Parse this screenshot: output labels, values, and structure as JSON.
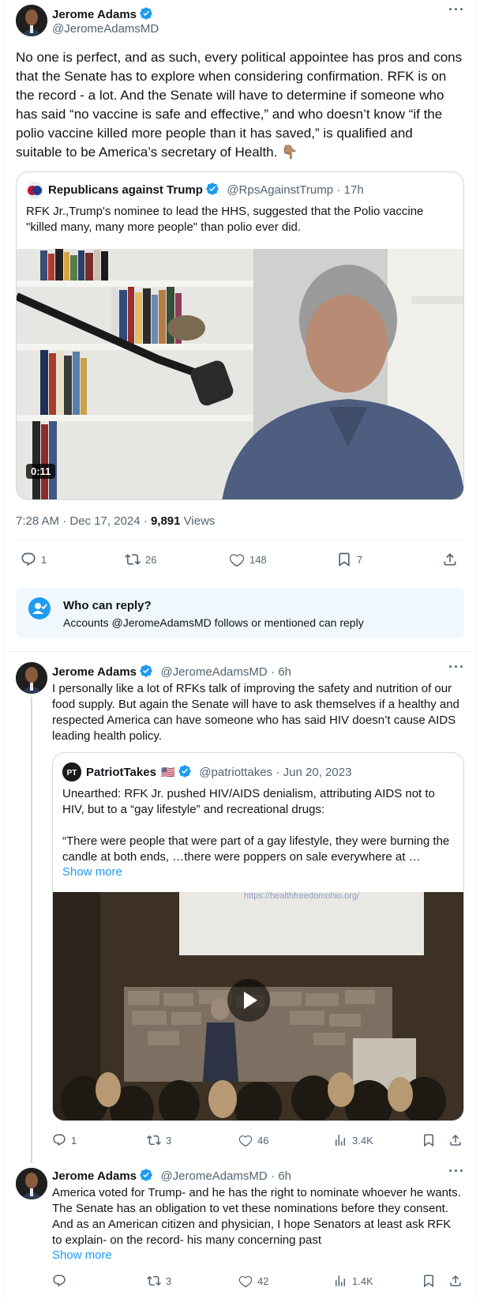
{
  "main_tweet": {
    "author_name": "Jerome Adams",
    "author_handle": "@JeromeAdamsMD",
    "text": "No one is perfect, and as such, every political appointee has pros and cons that the Senate has to explore when considering confirmation. RFK is on the record - a lot. And the Senate will have to determine if someone who has said “no vaccine is safe and effective,” and who doesn’t know “if the polio vaccine killed more people than it has saved,” is qualified and suitable to be America’s secretary of Health. 👇🏽",
    "quote": {
      "author_name": "Republicans against Trump",
      "author_handle": "@RpsAgainstTrump",
      "time": "· 17h",
      "text": "RFK Jr.,Trump's nominee to lead the HHS, suggested that the Polio vaccine \"killed many, many more people\" than polio ever did.",
      "video_duration": "0:11"
    },
    "timestamp": "7:28 AM · Dec 17, 2024 ·",
    "views_count": "9,891",
    "views_label": "Views",
    "replies": "1",
    "reposts": "26",
    "likes": "148",
    "bookmarks": "7",
    "who_can_reply_title": "Who can reply?",
    "who_can_reply_text": "Accounts @JeromeAdamsMD follows or mentioned can reply"
  },
  "reply_1": {
    "author_name": "Jerome Adams",
    "author_handle": "@JeromeAdamsMD",
    "time": "· 6h",
    "text": "I personally like a lot of RFKs talk of improving the safety and nutrition of our food supply. But again the Senate will have to ask themselves if a healthy and respected America can have someone who has said HIV doesn’t cause AIDS leading health policy.",
    "quote": {
      "author_name": "PatriotTakes",
      "flag": "🇺🇸",
      "author_handle": "@patriottakes",
      "time": "· Jun 20, 2023",
      "text_line1": "Unearthed: RFK Jr. pushed HIV/AIDS denialism, attributing AIDS not to HIV, but to a “gay lifestyle” and recreational drugs:",
      "text_line2": "“There were people that were part of a gay lifestyle, they were burning the candle at both ends, …there were poppers on sale everywhere at …",
      "show_more": "Show more",
      "screen_url": "https://healthfreedomohio.org/"
    },
    "replies": "1",
    "reposts": "3",
    "likes": "46",
    "views": "3.4K"
  },
  "reply_2": {
    "author_name": "Jerome Adams",
    "author_handle": "@JeromeAdamsMD",
    "time": "· 6h",
    "text": "America voted for Trump- and he has the right to nominate whoever he wants. The Senate has an obligation to vet these nominations before they consent. And as an American citizen and physician, I hope Senators at least ask RFK to explain- on the record- his many concerning past",
    "show_more": "Show more",
    "reposts": "3",
    "likes": "42",
    "views": "1.4K"
  },
  "colors": {
    "accent": "#1d9bf0",
    "text_secondary": "#536471",
    "border": "#cfd9de"
  },
  "icons": [
    "verified-badge-icon",
    "more-options-icon",
    "reply-icon",
    "repost-icon",
    "like-icon",
    "bookmark-icon",
    "share-icon",
    "views-icon",
    "play-icon",
    "mention-icon"
  ]
}
